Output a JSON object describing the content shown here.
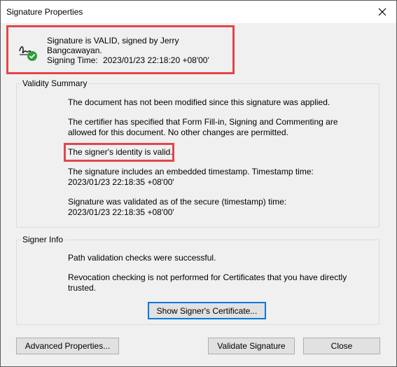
{
  "window": {
    "title": "Signature Properties"
  },
  "header": {
    "status_text": "Signature is VALID, signed by Jerry Bangcawayan.",
    "signing_time_label": "Signing Time:",
    "signing_time_value": "2023/01/23 22:18:20 +08'00'"
  },
  "validity_summary": {
    "title": "Validity Summary",
    "lines": [
      "The document has not been modified since this signature was applied.",
      "The certifier has specified that Form Fill-in, Signing and Commenting are allowed for this document. No other changes are permitted.",
      "The signer's identity is valid.",
      "The signature includes an embedded timestamp. Timestamp time: 2023/01/23 22:18:35 +08'00'",
      "Signature was validated as of the secure (timestamp) time: 2023/01/23 22:18:35 +08'00'"
    ]
  },
  "signer_info": {
    "title": "Signer Info",
    "lines": [
      "Path validation checks were successful.",
      "Revocation checking is not performed for Certificates that you have directly trusted."
    ],
    "show_cert_label": "Show Signer's Certificate..."
  },
  "buttons": {
    "advanced": "Advanced Properties...",
    "validate": "Validate Signature",
    "close": "Close"
  },
  "colors": {
    "highlight": "#e0474c",
    "check": "#2e9d3d",
    "focus": "#0078d7"
  }
}
